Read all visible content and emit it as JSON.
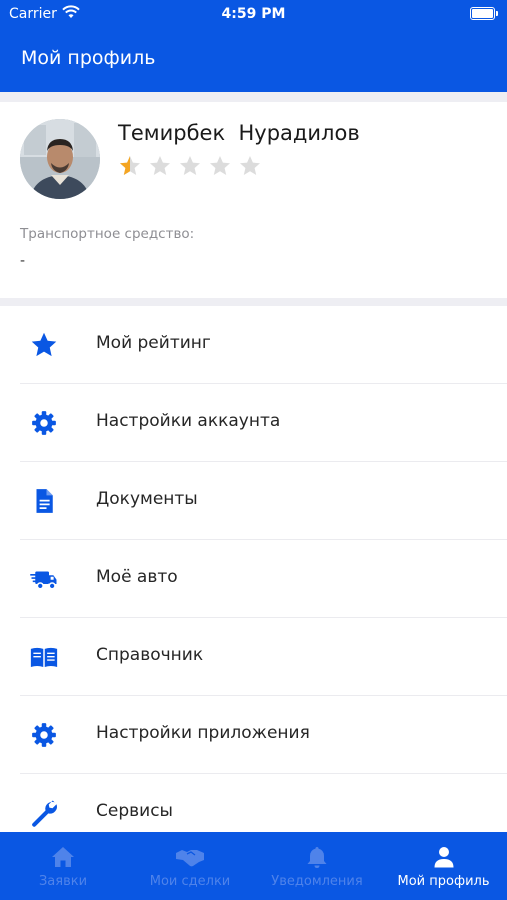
{
  "status_bar": {
    "carrier": "Carrier",
    "time": "4:59 PM"
  },
  "nav": {
    "title": "Мой профиль"
  },
  "profile": {
    "name": "Темирбек  Нурадилов",
    "rating": 0.5,
    "rating_max": 5,
    "vehicle_label": "Транспортное средство:",
    "vehicle_value": "-"
  },
  "menu": {
    "items": [
      {
        "label": "Мой рейтинг",
        "icon": "star-icon"
      },
      {
        "label": "Настройки аккаунта",
        "icon": "gear-icon"
      },
      {
        "label": "Документы",
        "icon": "document-icon"
      },
      {
        "label": "Моё авто",
        "icon": "truck-icon"
      },
      {
        "label": "Справочник",
        "icon": "book-icon"
      },
      {
        "label": "Настройки приложения",
        "icon": "gear-icon"
      },
      {
        "label": "Сервисы",
        "icon": "wrench-icon"
      }
    ]
  },
  "tabs": [
    {
      "label": "Заявки",
      "icon": "home-icon",
      "active": false
    },
    {
      "label": "Мои сделки",
      "icon": "handshake-icon",
      "active": false
    },
    {
      "label": "Уведомления",
      "icon": "bell-icon",
      "active": false
    },
    {
      "label": "Мой профиль",
      "icon": "person-icon",
      "active": true
    }
  ],
  "colors": {
    "primary": "#0a57e3",
    "star_filled": "#f4a522",
    "star_empty": "#dcdcdc",
    "tab_inactive": "#4f83ea",
    "tab_active": "#ffffff"
  }
}
